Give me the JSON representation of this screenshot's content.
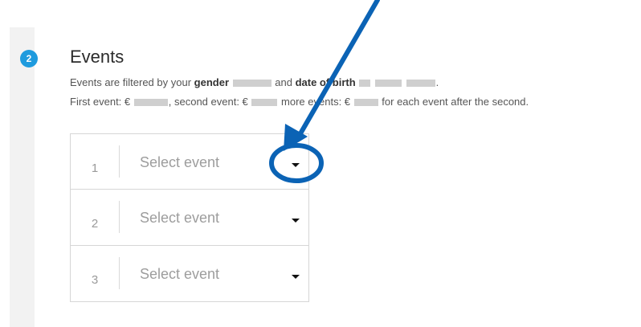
{
  "section": {
    "step_number": "2",
    "title": "Events"
  },
  "info": {
    "line1_prefix": "Events are filtered by your",
    "line1_gender_label": "gender",
    "line1_mid": "and",
    "line1_dob_label": "date of birth",
    "line1_suffix": ".",
    "line2_first": "First event: €",
    "line2_second": ", second event: €",
    "line2_more": "more events: €",
    "line2_suffix": "for each event after the second."
  },
  "events": [
    {
      "number": "1",
      "placeholder": "Select event"
    },
    {
      "number": "2",
      "placeholder": "Select event"
    },
    {
      "number": "3",
      "placeholder": "Select event"
    }
  ],
  "annotation": {
    "color": "#0b63b5"
  }
}
